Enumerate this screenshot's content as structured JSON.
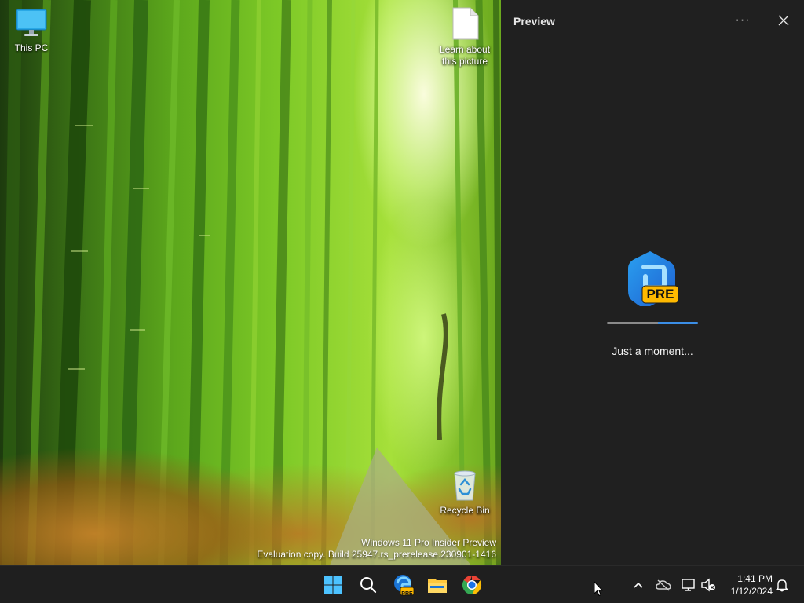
{
  "desktop": {
    "icons": [
      {
        "label": "This PC"
      },
      {
        "label": "Learn about this picture"
      },
      {
        "label": "Recycle Bin"
      }
    ],
    "watermark": {
      "line1": "Windows 11 Pro Insider Preview",
      "line2": "Evaluation copy. Build 25947.rs_prerelease.230901-1416"
    }
  },
  "pane": {
    "title": "Preview",
    "more_label": "···",
    "logo_badge": "PRE",
    "loading_text": "Just a moment...",
    "progress_fraction": 0.44,
    "accent": "#3b8ee6"
  },
  "taskbar": {
    "apps": [
      {
        "icon": "windows-start-icon"
      },
      {
        "icon": "search-icon"
      },
      {
        "icon": "edge-preview-icon",
        "badge": "PRE"
      },
      {
        "icon": "file-explorer-icon"
      },
      {
        "icon": "chrome-icon"
      }
    ],
    "clock": {
      "time": "1:41 PM",
      "date": "1/12/2024"
    }
  }
}
